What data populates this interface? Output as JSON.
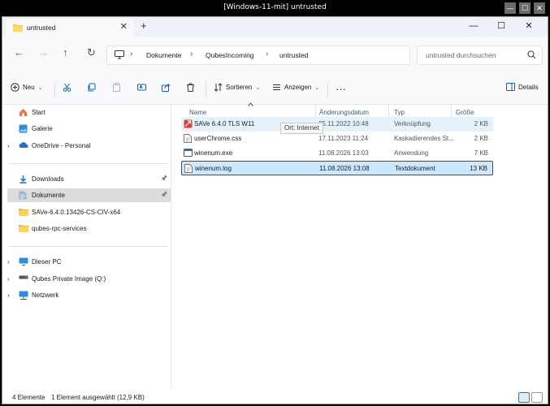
{
  "window": {
    "title": "[Windows-11-mit] untrusted",
    "controls": [
      "—",
      "☐",
      "✕"
    ]
  },
  "tabs": {
    "active": {
      "label": "untrusted",
      "close": "✕"
    },
    "new_tab": "+"
  },
  "nav": {
    "back": "←",
    "forward": "→",
    "up": "↑",
    "refresh": "↻",
    "breadcrumb": [
      "Dokumente",
      "QubesIncoming",
      "untrusted"
    ],
    "separator": "›",
    "search_placeholder": "untrusted durchsuchen"
  },
  "toolbar": {
    "new_label": "Neu",
    "sort_label": "Sortieren",
    "view_label": "Anzeigen",
    "more": "…",
    "details_label": "Details",
    "chevron": "⌄"
  },
  "sidebar": {
    "items": [
      {
        "label": "Start",
        "icon": "home-icon",
        "expand": ""
      },
      {
        "label": "Galerie",
        "icon": "gallery-icon",
        "expand": ""
      },
      {
        "label": "OneDrive - Personal",
        "icon": "cloud-icon",
        "expand": "›"
      },
      {
        "label": "Downloads",
        "icon": "download-icon",
        "expand": "",
        "pin": "📌"
      },
      {
        "label": "Dokumente",
        "icon": "document-icon",
        "expand": "",
        "pin": "📌"
      },
      {
        "label": "SAVe-6.4.0.13426-CS-CIV-x64",
        "icon": "folder-icon",
        "expand": ""
      },
      {
        "label": "qubes-rpc-services",
        "icon": "folder-icon",
        "expand": ""
      },
      {
        "label": "Dieser PC",
        "icon": "pc-icon",
        "expand": "›"
      },
      {
        "label": "Qubes Private Image (Q:)",
        "icon": "drive-icon",
        "expand": "›"
      },
      {
        "label": "Netzwerk",
        "icon": "network-icon",
        "expand": "›"
      }
    ]
  },
  "columns": [
    "Name",
    "Änderungsdatum",
    "Typ",
    "Größe"
  ],
  "files": [
    {
      "name": "SAVe 6.4.0 TLS W11",
      "date": "25.11.2022 10:48",
      "type": "Verknüpfung",
      "size": "2 KB",
      "icon": "shortcut-icon"
    },
    {
      "name": "userChrome.css",
      "date": "17.11.2023 11:24",
      "type": "Kaskadierendes St...",
      "size": "2 KB",
      "icon": "css-file-icon"
    },
    {
      "name": "winenum.exe",
      "date": "11.08.2026 13:03",
      "type": "Anwendung",
      "size": "7 KB",
      "icon": "exe-icon"
    },
    {
      "name": "winenum.log",
      "date": "11.08.2026 13:08",
      "type": "Textdokument",
      "size": "13 KB",
      "icon": "text-file-icon"
    }
  ],
  "tooltip": "Ort: Internet",
  "status": {
    "count": "4 Elemente",
    "selection": "1 Element ausgewählt (12,9 KB)"
  },
  "colors": {
    "accent": "#0067c0",
    "selection": "#cce8ff",
    "folder": "#f8c942"
  }
}
